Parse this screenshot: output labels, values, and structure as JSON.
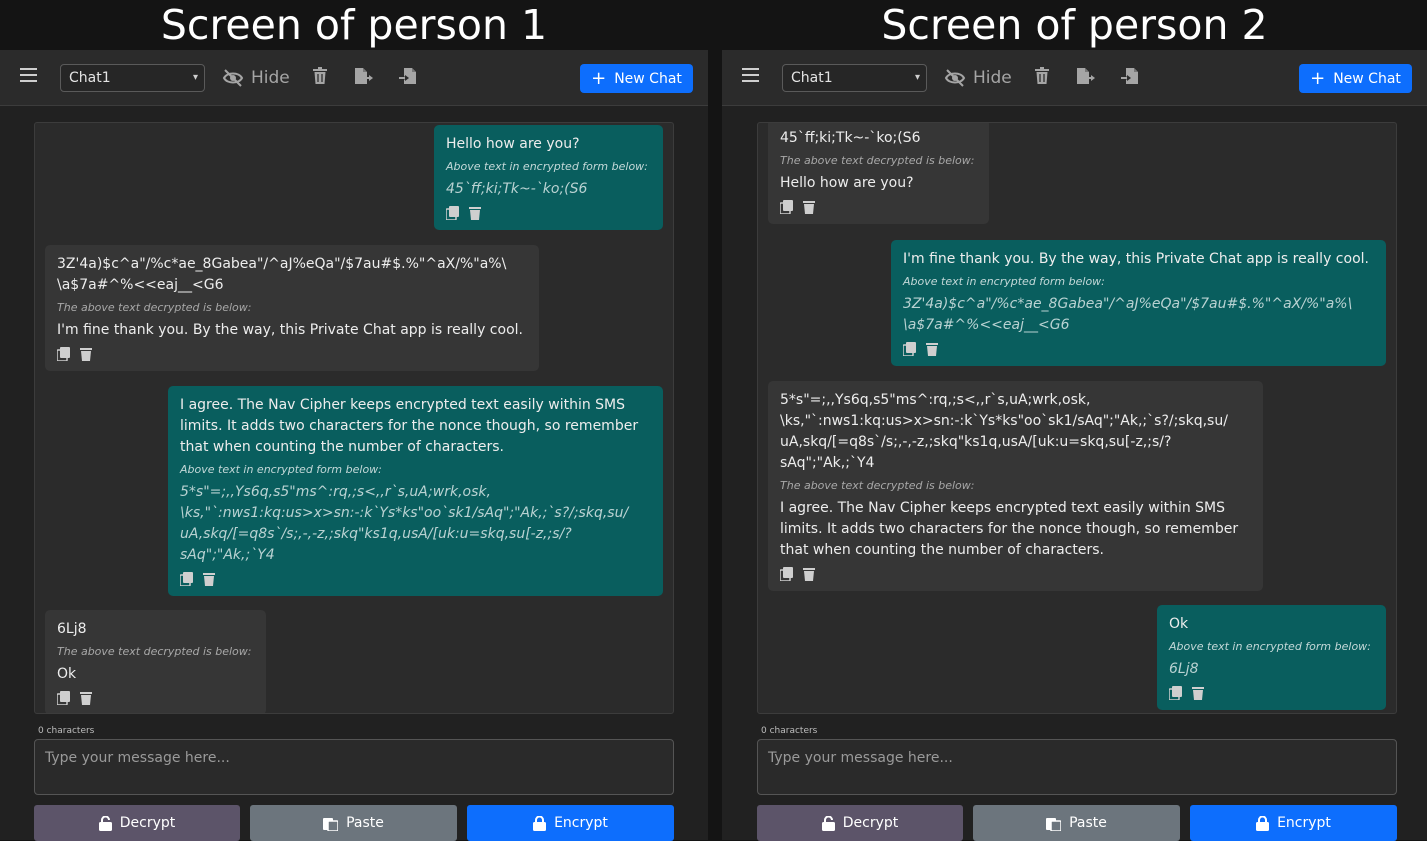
{
  "screens": [
    {
      "title": "Screen of person 1",
      "toolbar": {
        "chat_select": "Chat1",
        "hide_label": "Hide",
        "new_chat_label": "New Chat"
      },
      "messages": [
        {
          "type": "sent",
          "text": "Hello how are you?",
          "note": "Above text in encrypted form below:",
          "encrypted": "45`ff;ki;Tk~-`ko;(S6"
        },
        {
          "type": "recv",
          "encrypted": "3Z'4a)$c^a\"/%c*ae_8Gabea\"/^aJ%eQa\"/$7au#$.%\"^aX/%\"a%\\\n\\a$7a#^%<<eaj__<G6",
          "note": "The above text decrypted is below:",
          "text": "I'm fine thank you. By the way, this Private Chat app is really cool."
        },
        {
          "type": "sent",
          "text": "I agree. The Nav Cipher keeps encrypted text easily within SMS limits. It adds two characters for the nonce though, so remember that when counting the number of characters.",
          "note": "Above text in encrypted form below:",
          "encrypted": "5*s\"=;,,Ys6q,s5\"ms^:rq,;s<,,r`s,uA;wrk,osk,\n\\ks,\"`:nws1:kq:us>x>sn:-:k`Ys*ks\"oo`sk1/sAq\";\"Ak,;`s?/;skq,su/\nuA,skq/[=q8s`/s;,-,-z,;skq\"ks1q,usA/[uk:u=skq,su[-z,;s/?\nsAq\";\"Ak,;`Y4"
        },
        {
          "type": "recv",
          "encrypted": "6Lj8",
          "note": "The above text decrypted is below:",
          "text": "Ok"
        }
      ],
      "counter": "0 characters",
      "input_placeholder": "Type your message here...",
      "buttons": {
        "decrypt": "Decrypt",
        "paste": "Paste",
        "encrypt": "Encrypt"
      }
    },
    {
      "title": "Screen of person 2",
      "toolbar": {
        "chat_select": "Chat1",
        "hide_label": "Hide",
        "new_chat_label": "New Chat"
      },
      "messages": [
        {
          "type": "recv",
          "encrypted": "45`ff;ki;Tk~-`ko;(S6",
          "note": "The above text decrypted is below:",
          "text": "Hello how are you?"
        },
        {
          "type": "sent",
          "text": "I'm fine thank you. By the way, this Private Chat app is really cool.",
          "note": "Above text in encrypted form below:",
          "encrypted": "3Z'4a)$c^a\"/%c*ae_8Gabea\"/^aJ%eQa\"/$7au#$.%\"^aX/%\"a%\\\n\\a$7a#^%<<eaj__<G6"
        },
        {
          "type": "recv",
          "encrypted": "5*s\"=;,,Ys6q,s5\"ms^:rq,;s<,,r`s,uA;wrk,osk,\n\\ks,\"`:nws1:kq:us>x>sn:-:k`Ys*ks\"oo`sk1/sAq\";\"Ak,;`s?/;skq,su/\nuA,skq/[=q8s`/s;,-,-z,;skq\"ks1q,usA/[uk:u=skq,su[-z,;s/?\nsAq\";\"Ak,;`Y4",
          "note": "The above text decrypted is below:",
          "text": "I agree. The Nav Cipher keeps encrypted text easily within SMS limits. It adds two characters for the nonce though, so remember that when counting the number of characters."
        },
        {
          "type": "sent",
          "text": "Ok",
          "note": "Above text in encrypted form below:",
          "encrypted": "6Lj8"
        }
      ],
      "counter": "0 characters",
      "input_placeholder": "Type your message here...",
      "buttons": {
        "decrypt": "Decrypt",
        "paste": "Paste",
        "encrypt": "Encrypt"
      }
    }
  ],
  "colors": {
    "accent": "#0d6efd",
    "sent_bubble": "#095e5e",
    "recv_bubble": "#363636",
    "decrypt_button": "#5c5469",
    "paste_button": "#6c757d"
  },
  "icons": [
    "menu-icon",
    "eye-slash-icon",
    "trash-icon",
    "export-icon",
    "import-icon",
    "plus-icon",
    "copy-icon",
    "unlock-icon",
    "clipboard-icon",
    "lock-icon",
    "chevron-down-icon"
  ]
}
